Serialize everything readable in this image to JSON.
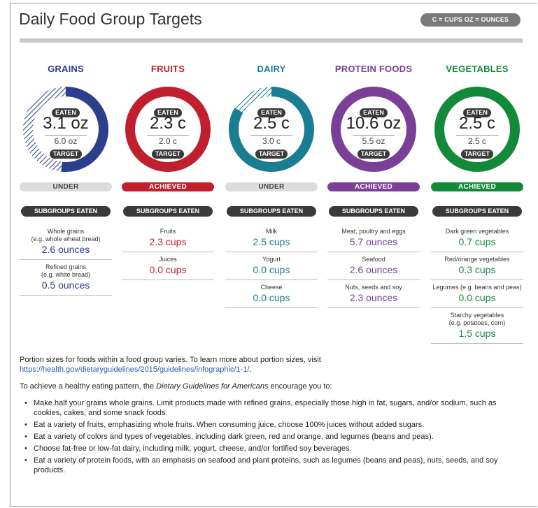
{
  "page": {
    "title": "Daily Food Group Targets",
    "units_legend": "C = CUPS  OZ = OUNCES"
  },
  "labels": {
    "eaten": "EATEN",
    "target": "TARGET",
    "subgroups_eaten": "SUBGROUPS EATEN"
  },
  "groups": [
    {
      "name": "GRAINS",
      "color": "#2b3f8c",
      "eaten": "3.1 oz",
      "target": "6.0 oz",
      "eaten_fraction": 0.517,
      "status": "UNDER",
      "subgroups": [
        {
          "label": "Whole grains\n(e.g. whole wheat bread)",
          "value": "2.6 ounces"
        },
        {
          "label": "Refined grains\n(e.g. white bread)",
          "value": "0.5 ounces"
        }
      ]
    },
    {
      "name": "FRUITS",
      "color": "#c0202e",
      "eaten": "2.3 c",
      "target": "2.0 c",
      "eaten_fraction": 1.0,
      "status": "ACHIEVED",
      "subgroups": [
        {
          "label": "Fruits",
          "value": "2.3 cups"
        },
        {
          "label": "Juices",
          "value": "0.0 cups"
        }
      ]
    },
    {
      "name": "DAIRY",
      "color": "#1a7d91",
      "eaten": "2.5 c",
      "target": "3.0 c",
      "eaten_fraction": 0.833,
      "status": "UNDER",
      "subgroups": [
        {
          "label": "Milk",
          "value": "2.5 cups"
        },
        {
          "label": "Yogurt",
          "value": "0.0 cups"
        },
        {
          "label": "Cheese",
          "value": "0.0 cups"
        }
      ]
    },
    {
      "name": "PROTEIN FOODS",
      "color": "#7b3f98",
      "eaten": "10.6 oz",
      "target": "5.5 oz",
      "eaten_fraction": 1.0,
      "status": "ACHIEVED",
      "subgroups": [
        {
          "label": "Meat, poultry and eggs",
          "value": "5.7 ounces"
        },
        {
          "label": "Seafood",
          "value": "2.6 ounces"
        },
        {
          "label": "Nuts, seeds and soy",
          "value": "2.3 ounces"
        }
      ]
    },
    {
      "name": "VEGETABLES",
      "color": "#138a3a",
      "eaten": "2.5 c",
      "target": "2.5 c",
      "eaten_fraction": 1.0,
      "status": "ACHIEVED",
      "subgroups": [
        {
          "label": "Dark green vegetables",
          "value": "0.7 cups"
        },
        {
          "label": "Red/orange vegetables",
          "value": "0.3 cups"
        },
        {
          "label": "Legumes (e.g. beans and peas)",
          "value": "0.0 cups"
        },
        {
          "label": "Starchy vegetables\n(e.g. potatoes, corn)",
          "value": "1.5 cups"
        }
      ]
    }
  ],
  "notes": {
    "portion_text": "Portion sizes for foods within a food group varies. To learn more about portion sizes, visit",
    "portion_link": "https://health.gov/dietaryguidelines/2015/guidelines/infographic/1-1/",
    "portion_link_suffix": ".",
    "intro_before": "To achieve a healthy eating pattern, the ",
    "intro_em": "Dietary Guidelines for Americans",
    "intro_after": " encourage you to:",
    "bullets": [
      "Make half your grains whole grains. Limit products made with refined grains, especially those high in fat, sugars, and/or sodium, such as cookies, cakes, and some snack foods.",
      "Eat a variety of fruits, emphasizing whole fruits. When consuming juice, choose 100% juices without added sugars.",
      "Eat a variety of colors and types of vegetables, including dark green, red and orange, and legumes (beans and peas).",
      "Choose fat-free or low-fat dairy, including milk, yogurt, cheese, and/or fortified soy beverages.",
      "Eat a variety of protein foods, with an emphasis on seafood and plant proteins, such as legumes (beans and peas), nuts, seeds, and soy products."
    ]
  }
}
